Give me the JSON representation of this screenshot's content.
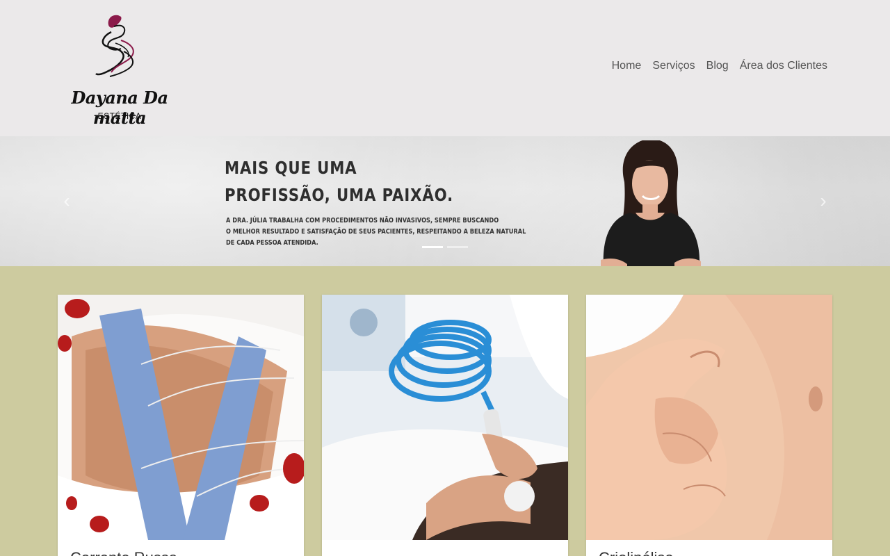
{
  "brand": {
    "name": "Dayana Da matta",
    "subtitle": "ESTÉTICA"
  },
  "nav": {
    "items": [
      {
        "label": "Home"
      },
      {
        "label": "Serviços"
      },
      {
        "label": "Blog"
      },
      {
        "label": "Área dos Clientes"
      }
    ]
  },
  "hero": {
    "title_line1": "MAIS QUE UMA",
    "title_line2": "PROFISSÃO, UMA PAIXÃO.",
    "desc_line1": "A DRA. JÚLIA TRABALHA COM PROCEDIMENTOS NÃO INVASIVOS, SEMPRE BUSCANDO",
    "desc_line2": "O MELHOR RESULTADO E SATISFAÇÃO DE SEUS PACIENTES, RESPEITANDO A BELEZA NATURAL",
    "desc_line3": "DE CADA PESSOA ATENDIDA.",
    "prev_icon": "chevron-left-icon",
    "next_icon": "chevron-right-icon",
    "slides_count": 2,
    "active_slide": 1
  },
  "services": {
    "cards": [
      {
        "title": "Corrente Russa"
      },
      {
        "title": ""
      },
      {
        "title": "Criolipólise"
      }
    ]
  },
  "colors": {
    "header_bg": "#ebe9ea",
    "services_bg": "#cdcb9f",
    "nav_text": "#555555",
    "logo_accent": "#8b1a4a"
  }
}
